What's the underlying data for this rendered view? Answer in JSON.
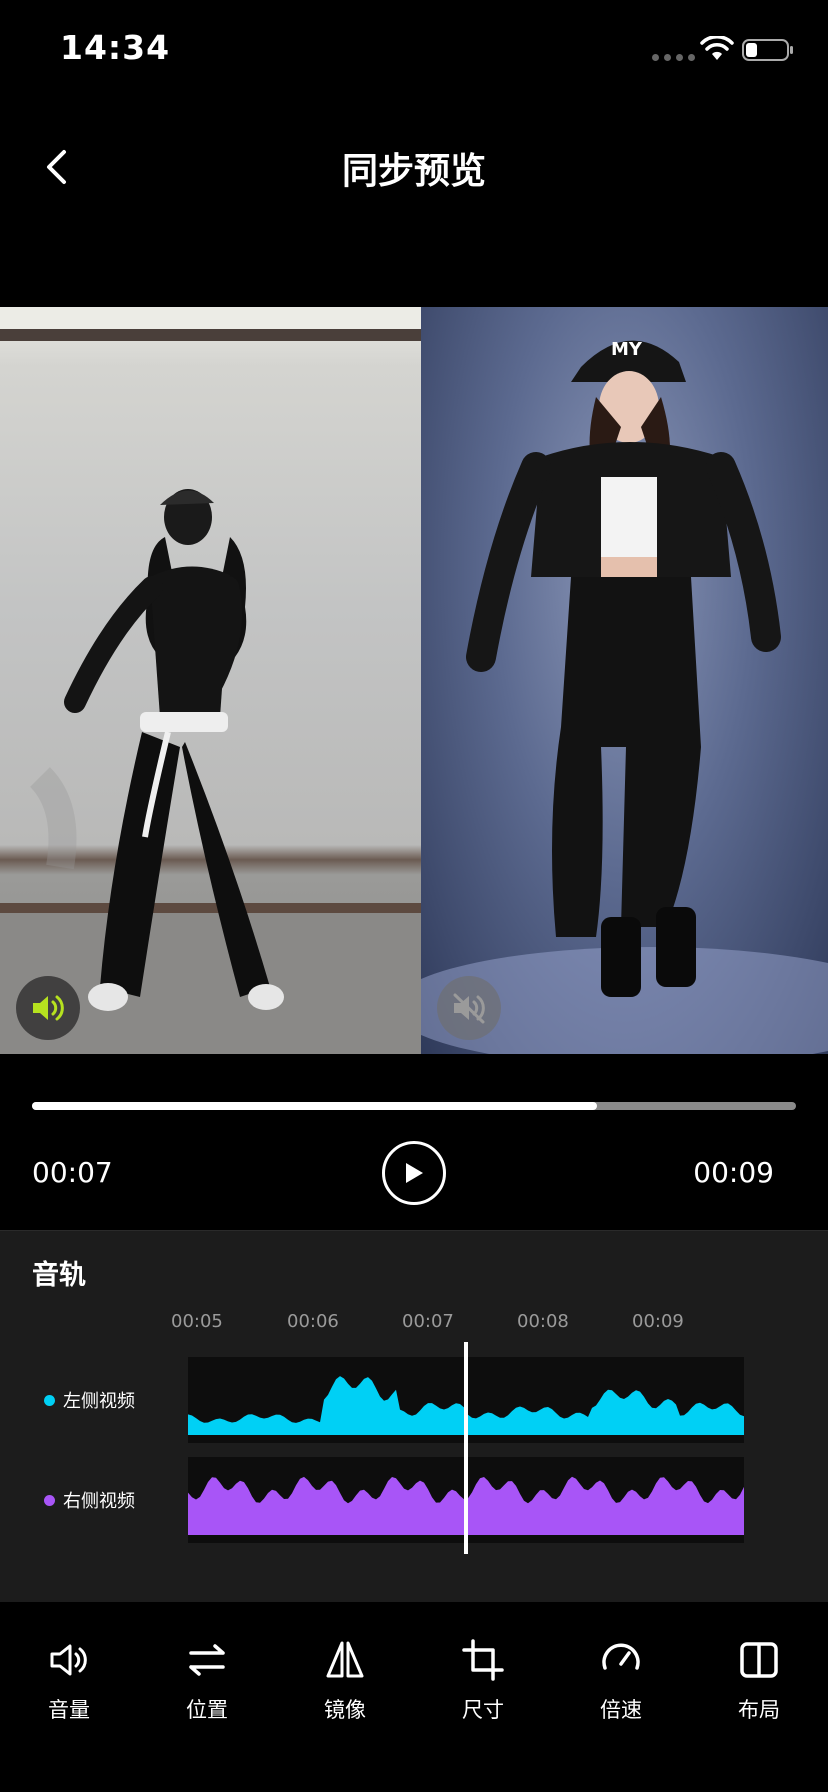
{
  "status": {
    "time": "14:34"
  },
  "nav": {
    "title": "同步预览"
  },
  "player": {
    "current_time": "00:07",
    "total_time": "00:09",
    "progress": 0.74
  },
  "left_video": {
    "audio": "on",
    "audio_color": "#b6e21f"
  },
  "right_video": {
    "audio": "muted"
  },
  "tracks": {
    "title": "音轨",
    "ruler": [
      "00:05",
      "00:06",
      "00:07",
      "00:08",
      "00:09"
    ],
    "items": [
      {
        "label": "左侧视频",
        "color": "#00d0f5"
      },
      {
        "label": "右侧视频",
        "color": "#a855f7"
      }
    ]
  },
  "toolbar": {
    "items": [
      {
        "label": "音量",
        "icon": "speaker-icon"
      },
      {
        "label": "位置",
        "icon": "swap-icon"
      },
      {
        "label": "镜像",
        "icon": "mirror-icon"
      },
      {
        "label": "尺寸",
        "icon": "crop-icon"
      },
      {
        "label": "倍速",
        "icon": "speedometer-icon"
      },
      {
        "label": "布局",
        "icon": "split-layout-icon"
      }
    ]
  }
}
